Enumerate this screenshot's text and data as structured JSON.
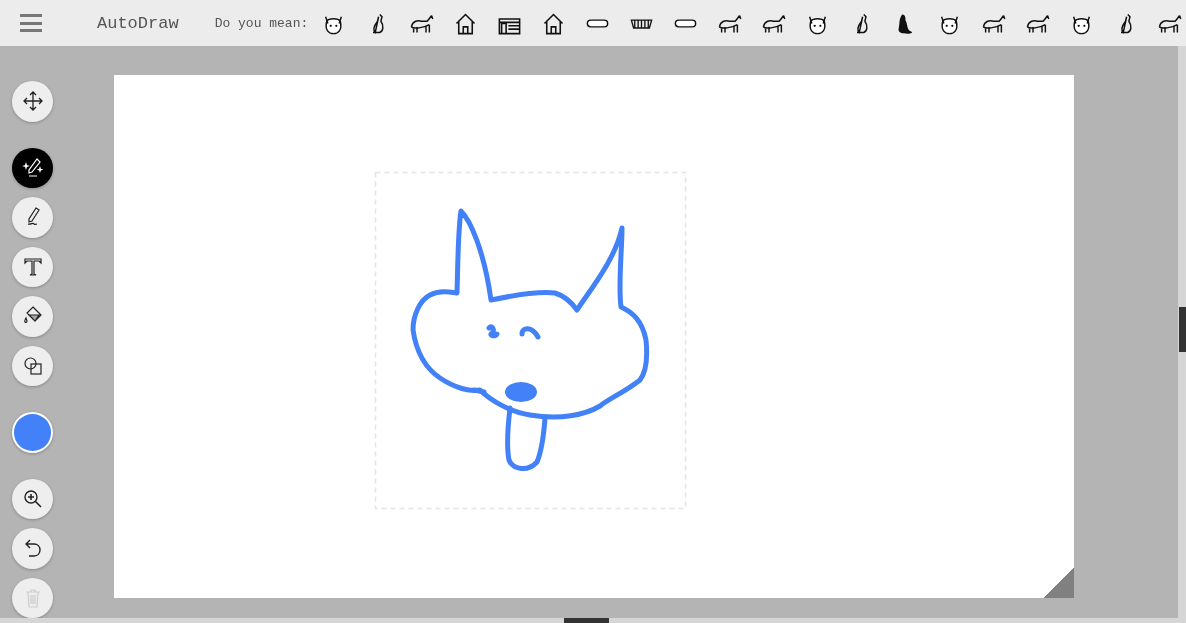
{
  "app": {
    "title": "AutoDraw"
  },
  "suggestions": {
    "label": "Do you mean:"
  },
  "tools": [
    {
      "kind": "move",
      "selected": false,
      "disabled": false
    },
    {
      "kind": "autodraw",
      "selected": true,
      "disabled": false
    },
    {
      "kind": "draw",
      "selected": false,
      "disabled": false
    },
    {
      "kind": "type",
      "selected": false,
      "disabled": false
    },
    {
      "kind": "fill",
      "selected": false,
      "disabled": false
    },
    {
      "kind": "shape",
      "selected": false,
      "disabled": false
    },
    {
      "kind": "color",
      "color": "#4281f7"
    },
    {
      "kind": "zoom",
      "selected": false,
      "disabled": false
    },
    {
      "kind": "undo",
      "selected": false,
      "disabled": false
    },
    {
      "kind": "delete",
      "selected": false,
      "disabled": true
    }
  ]
}
